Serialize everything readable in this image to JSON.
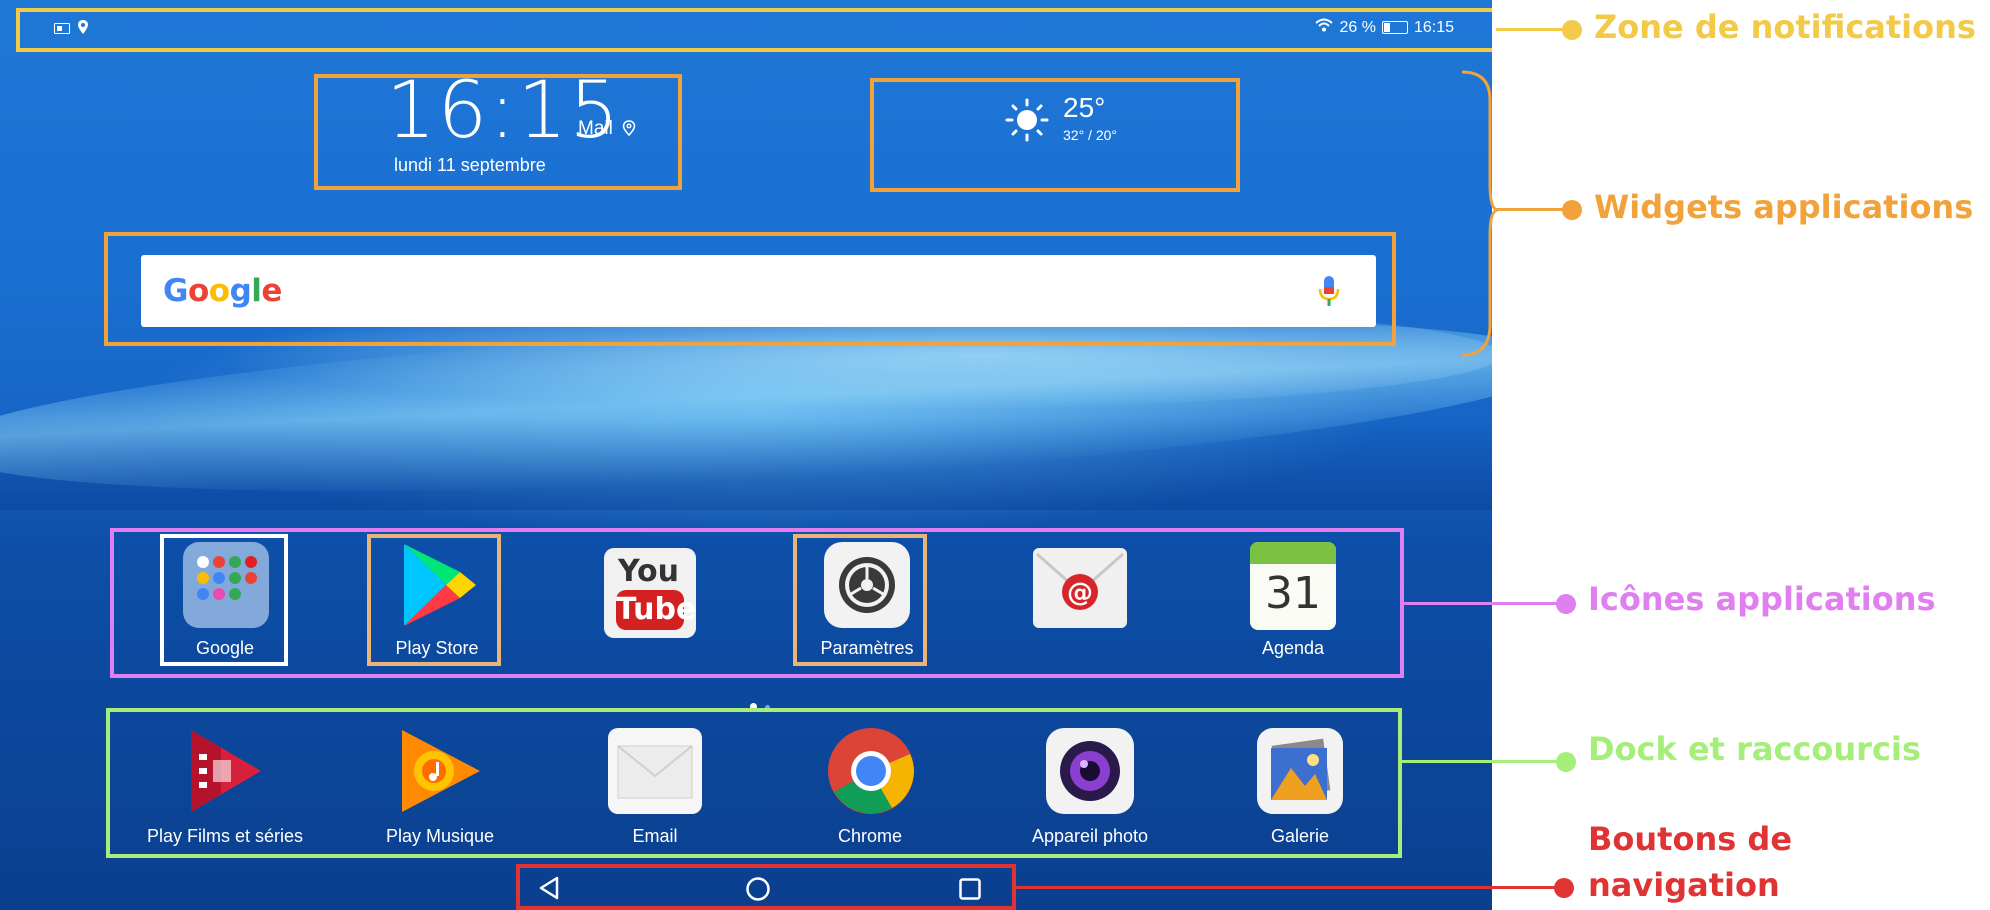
{
  "status_bar": {
    "left_icons": [
      "sim-icon",
      "location-icon"
    ],
    "wifi": "wifi-icon",
    "battery_text": "26 %",
    "time": "16:15"
  },
  "clock_widget": {
    "time": "16:15",
    "city": "Mail",
    "date": "lundi 11 septembre"
  },
  "weather_widget": {
    "temperature": "25°",
    "range": "32° / 20°",
    "icon": "sun-icon"
  },
  "search": {
    "logo": "Google",
    "mic_icon": "mic-icon"
  },
  "apps": [
    {
      "label": "Google",
      "icon": "google-folder-icon"
    },
    {
      "label": "Play Store",
      "icon": "play-store-icon"
    },
    {
      "label": "",
      "icon": "youtube-icon"
    },
    {
      "label": "Paramètres",
      "icon": "settings-icon"
    },
    {
      "label": "",
      "icon": "mail-at-icon"
    },
    {
      "label": "Agenda",
      "icon": "calendar-icon",
      "day": "31"
    }
  ],
  "dock": [
    {
      "label": "Play Films et séries",
      "icon": "play-movies-icon"
    },
    {
      "label": "Play Musique",
      "icon": "play-music-icon"
    },
    {
      "label": "Email",
      "icon": "email-icon"
    },
    {
      "label": "Chrome",
      "icon": "chrome-icon"
    },
    {
      "label": "Appareil photo",
      "icon": "camera-icon"
    },
    {
      "label": "Galerie",
      "icon": "gallery-icon"
    }
  ],
  "nav_buttons": [
    "back-icon",
    "home-icon",
    "recents-icon"
  ],
  "annotations": {
    "notifications": "Zone de notifications",
    "widgets": "Widgets applications",
    "icons": "Icônes applications",
    "dock": "Dock et raccourcis",
    "nav_line1": "Boutons de",
    "nav_line2": "navigation"
  },
  "colors": {
    "notifications": "#f3c948",
    "widgets": "#f2a23a",
    "icons": "#e07ff0",
    "dock": "#a5ee79",
    "nav": "#e03434"
  }
}
